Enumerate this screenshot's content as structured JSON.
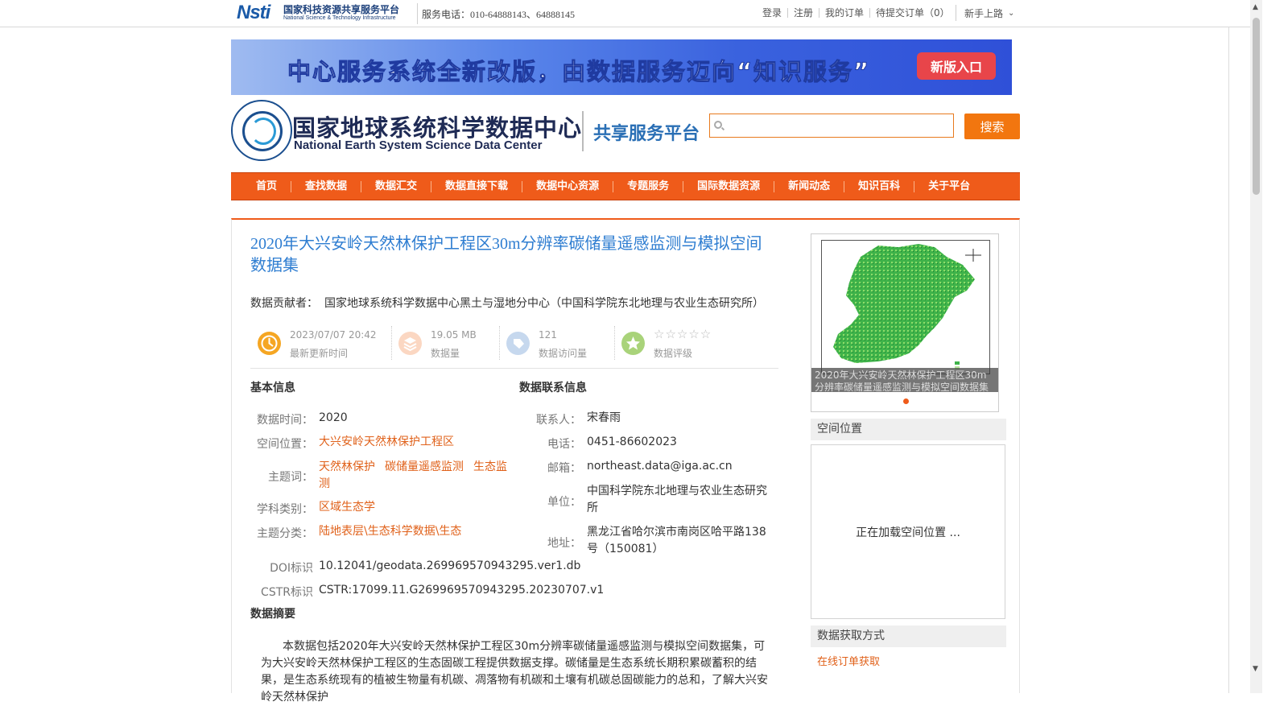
{
  "topbar": {
    "logo_mark": "Nsti",
    "logo_cn": "国家科技资源共享服务平台",
    "logo_en": "National Science & Technology Infrastructure",
    "hotline": "服务电话：010-64888143、64888145",
    "links": [
      "登录",
      "注册",
      "我的订单",
      "待提交订单（0）"
    ],
    "guide_label": "新手上路"
  },
  "banner": {
    "text": "中心服务系统全新改版，由数据服务迈向“知识服务”",
    "button": "新版入口"
  },
  "brand": {
    "cn": "国家地球系统科学数据中心",
    "en": "National Earth System Science Data Center",
    "platform": "共享服务平台"
  },
  "search": {
    "value": "",
    "button": "搜索"
  },
  "nav": [
    "首页",
    "查找数据",
    "数据汇交",
    "数据直接下载",
    "数据中心资源",
    "专题服务",
    "国际数据资源",
    "新闻动态",
    "知识百科",
    "关于平台"
  ],
  "dataset": {
    "title": "2020年大兴安岭天然林保护工程区30m分辨率碳储量遥感监测与模拟空间数据集",
    "contributor_label": "数据贡献者：",
    "contributor": "国家地球系统科学数据中心黑土与湿地分中心（中国科学院东北地理与农业生态研究所）"
  },
  "stats": {
    "updated": {
      "value": "2023/07/07 20:42",
      "label": "最新更新时间"
    },
    "size": {
      "value": "19.05 MB",
      "label": "数据量"
    },
    "visits": {
      "value": "121",
      "label": "数据访问量"
    },
    "rating": {
      "stars": "☆☆☆☆☆",
      "label": "数据评级"
    }
  },
  "basic": {
    "heading": "基本信息",
    "time_label": "数据时间：",
    "time": "2020",
    "location_label": "空间位置：",
    "location": "大兴安岭天然林保护工程区",
    "keywords_label": "主题词：",
    "keywords": [
      "天然林保护",
      "碳储量遥感监测",
      "生态监测"
    ],
    "discipline_label": "学科类别：",
    "discipline": "区域生态学",
    "category_label": "主题分类：",
    "category": "陆地表层\\生态科学数据\\生态",
    "doi_label": "DOI标识",
    "doi": "10.12041/geodata.269969570943295.ver1.db",
    "cstr_label": "CSTR标识",
    "cstr": "CSTR:17099.11.G269969570943295.20230707.v1"
  },
  "contact": {
    "heading": "数据联系信息",
    "person_label": "联系人：",
    "person": "宋春雨",
    "phone_label": "电话：",
    "phone": "0451-86602023",
    "email_label": "邮箱：",
    "email": "northeast.data@iga.ac.cn",
    "unit_label": "单位：",
    "unit": "中国科学院东北地理与农业生态研究所",
    "address_label": "地址：",
    "address": "黑龙江省哈尔滨市南岗区哈平路138号（150081）"
  },
  "abstract": {
    "heading": "数据摘要",
    "text": "本数据包括2020年大兴安岭天然林保护工程区30m分辨率碳储量遥感监测与模拟空间数据集，可为大兴安岭天然林保护工程区的生态固碳工程提供数据支撑。碳储量是生态系统长期积累碳蓄积的结果，是生态系统现有的植被生物量有机碳、凋落物有机碳和土壤有机碳总固碳能力的总和，了解大兴安岭天然林保护"
  },
  "sidebar": {
    "thumb_caption": "2020年大兴安岭天然林保护工程区30m分辨率碳储量遥感监测与模拟空间数据集",
    "spatial_heading": "空间位置",
    "spatial_loading": "正在加载空间位置 ...",
    "access_heading": "数据获取方式",
    "access_link": "在线订单获取"
  },
  "colors": {
    "accent": "#ef5b1a",
    "link": "#e0611a",
    "title_blue": "#2e7dd1"
  }
}
